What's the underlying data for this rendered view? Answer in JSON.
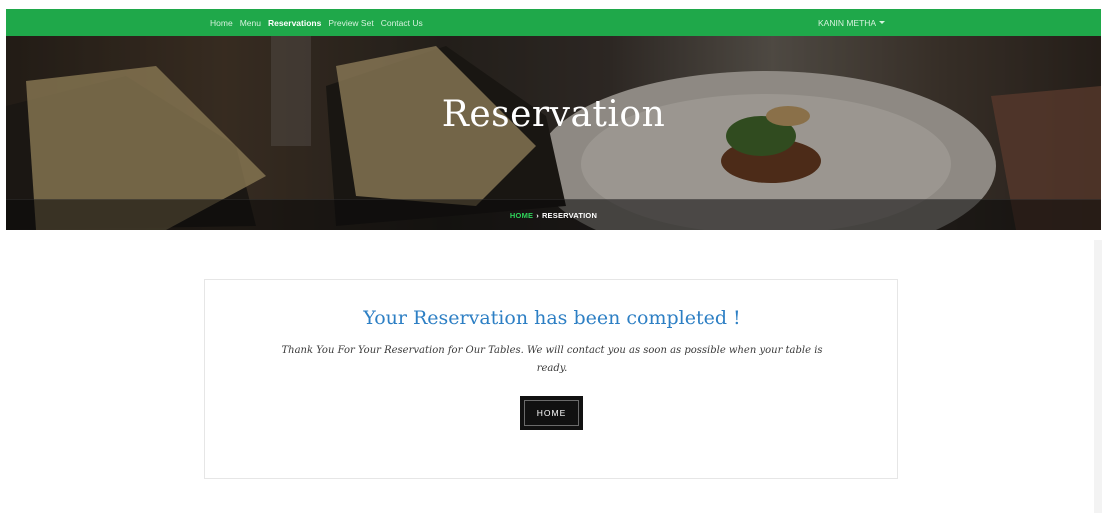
{
  "navbar": {
    "links": [
      {
        "label": "Home",
        "active": false
      },
      {
        "label": "Menu",
        "active": false
      },
      {
        "label": "Reservations",
        "active": true
      },
      {
        "label": "Preview Set",
        "active": false
      },
      {
        "label": "Contact Us",
        "active": false
      }
    ],
    "user": "KANIN METHA"
  },
  "hero": {
    "title": "Reservation",
    "breadcrumb": {
      "home": "HOME",
      "separator": "›",
      "current": "RESERVATION"
    }
  },
  "confirmation": {
    "title": "Your Reservation has been completed !",
    "message": "Thank You For Your Reservation for Our Tables. We will contact you as soon as possible when your table is ready.",
    "button_label": "HOME"
  },
  "colors": {
    "nav_green": "#1fa84a",
    "breadcrumb_green": "#2fd35a",
    "title_blue": "#2d7fc4",
    "button_black": "#111111"
  }
}
